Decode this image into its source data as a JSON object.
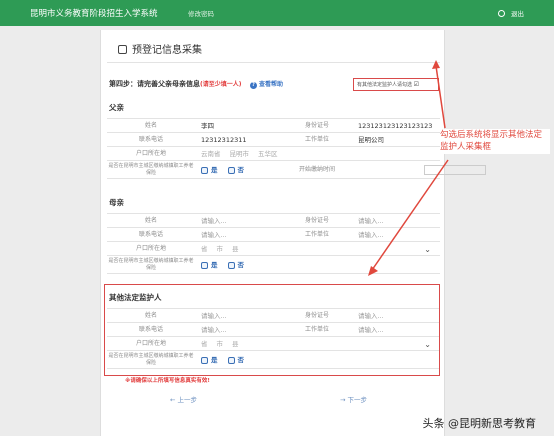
{
  "topbar": {
    "title": "昆明市义务教育阶段招生入学系统",
    "edit_link": "修改密码",
    "logout": "退出"
  },
  "page": {
    "title": "预登记信息采集",
    "step": "第四步：请完善父亲母亲信息",
    "step_required": "(请至少填一人)",
    "help": "查看帮助",
    "guardian_checkbox": "有其他法定监护人请勾选"
  },
  "father": {
    "header": "父亲",
    "name_label": "姓名",
    "name_value": "李四",
    "id_label": "身份证号",
    "id_value": "123123123123123123",
    "phone_label": "联系电话",
    "phone_value": "12312312311",
    "work_label": "工作单位",
    "work_value": "昆明公司",
    "hukou_label": "户口所在地",
    "hukou_province": "云南省",
    "hukou_city": "昆明市",
    "hukou_district": "五华区",
    "insurance_label": "是否在昆明市主城区缴纳城镇职工养老保险",
    "yes": "是",
    "no": "否",
    "start_label": "开始缴纳时间"
  },
  "mother": {
    "header": "母亲",
    "name_label": "姓名",
    "name_ph": "请输入...",
    "id_label": "身份证号",
    "id_ph": "请输入...",
    "phone_label": "联系电话",
    "phone_ph": "请输入...",
    "work_label": "工作单位",
    "work_ph": "请输入...",
    "hukou_label": "户口所在地",
    "hukou_province": "省",
    "hukou_city": "市",
    "hukou_district": "县",
    "insurance_label": "是否在昆明市主城区缴纳城镇职工养老保险",
    "yes": "是",
    "no": "否"
  },
  "guardian": {
    "header": "其他法定监护人",
    "name_label": "姓名",
    "name_ph": "请输入...",
    "id_label": "身份证号",
    "id_ph": "请输入...",
    "phone_label": "联系电话",
    "phone_ph": "请输入...",
    "work_label": "工作单位",
    "work_ph": "请输入...",
    "hukou_label": "户口所在地",
    "hukou_province": "省",
    "hukou_city": "市",
    "hukou_district": "县",
    "insurance_label": "是否在昆明市主城区缴纳城镇职工养老保险",
    "yes": "是",
    "no": "否"
  },
  "footer": {
    "note": "※请确保以上所填写信息真实有效!",
    "prev": "上一步",
    "next": "下一步"
  },
  "annotation": "勾选后系统将显示其他法定监护人采集框",
  "watermark": "头条 @昆明新思考教育",
  "colors": {
    "brand": "#2e9b55",
    "alert": "#e0483d",
    "link": "#3a74c4"
  }
}
